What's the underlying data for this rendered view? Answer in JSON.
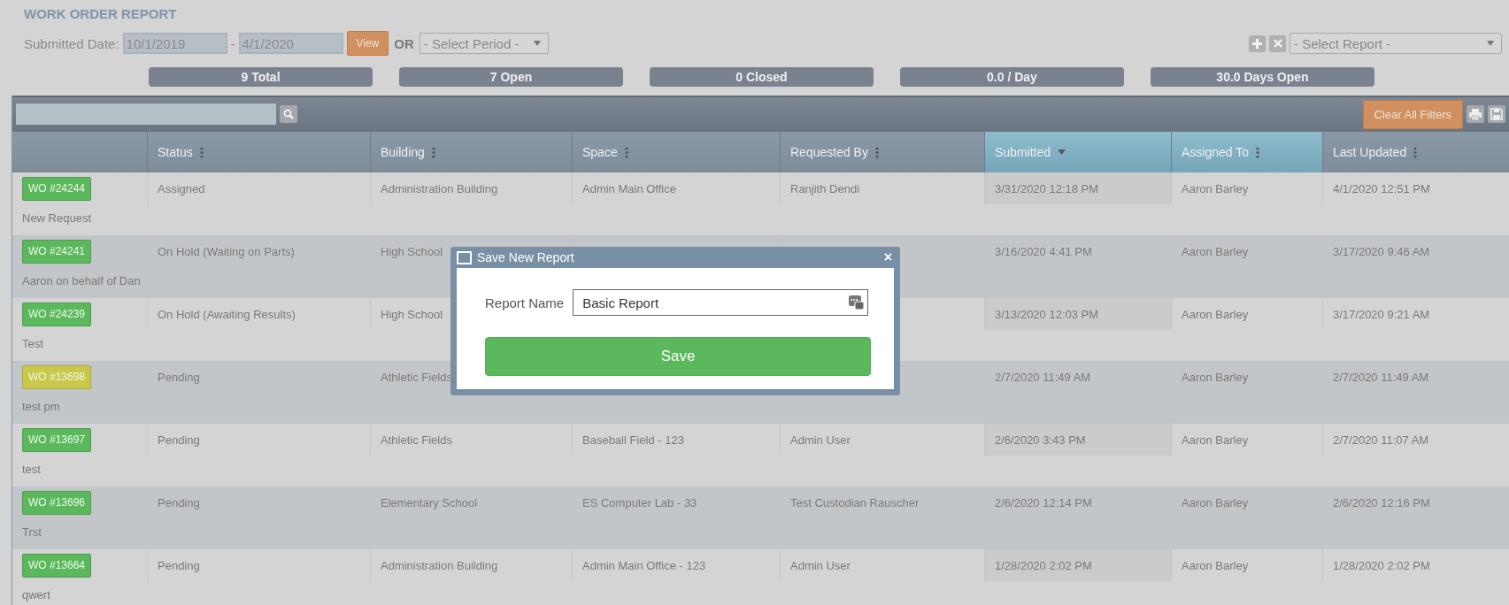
{
  "title": "WORK ORDER REPORT",
  "filters": {
    "label": "Submitted Date:",
    "from": "10/1/2019",
    "separator": "-",
    "to": "4/1/2020",
    "view_button": "View",
    "or_label": "OR",
    "period_placeholder": "- Select Period -",
    "report_placeholder": "- Select Report -"
  },
  "stats": [
    "9 Total",
    "7 Open",
    "0 Closed",
    "0.0 / Day",
    "30.0 Days Open"
  ],
  "toolbar": {
    "clear_button": "Clear All Filters"
  },
  "columns": [
    {
      "label": "Status",
      "sorted": false,
      "highlighted": false
    },
    {
      "label": "Building",
      "sorted": false,
      "highlighted": false
    },
    {
      "label": "Space",
      "sorted": false,
      "highlighted": false
    },
    {
      "label": "Requested By",
      "sorted": false,
      "highlighted": false
    },
    {
      "label": "Submitted",
      "sorted": true,
      "highlighted": true
    },
    {
      "label": "Assigned To",
      "sorted": false,
      "highlighted": true
    },
    {
      "label": "Last Updated",
      "sorted": false,
      "highlighted": false
    }
  ],
  "rows": [
    {
      "wo": "WO #24244",
      "color": "#5cb85c",
      "cells": [
        "Assigned",
        "Administration Building",
        "Admin Main Office",
        "Ranjith Dendi",
        "3/31/2020 12:18 PM",
        "Aaron Barley",
        "4/1/2020 12:51 PM"
      ],
      "description": "New Request"
    },
    {
      "wo": "WO #24241",
      "color": "#5cb85c",
      "cells": [
        "On Hold (Waiting on Parts)",
        "High School",
        null,
        null,
        "3/16/2020 4:41 PM",
        "Aaron Barley",
        "3/17/2020 9:46 AM"
      ],
      "description": "Aaron on behalf of Dan"
    },
    {
      "wo": "WO #24239",
      "color": "#5cb85c",
      "cells": [
        "On Hold (Awaiting Results)",
        "High School",
        null,
        null,
        "3/13/2020 12:03 PM",
        "Aaron Barley",
        "3/17/2020 9:21 AM"
      ],
      "description": "Test"
    },
    {
      "wo": "WO #13698",
      "color": "#c9c84a",
      "cells": [
        "Pending",
        "Athletic Fields",
        null,
        null,
        "2/7/2020 11:49 AM",
        "Aaron Barley",
        "2/7/2020 11:49 AM"
      ],
      "description": "test pm"
    },
    {
      "wo": "WO #13697",
      "color": "#5cb85c",
      "cells": [
        "Pending",
        "Athletic Fields",
        "Baseball Field - 123",
        "Admin User",
        "2/6/2020 3:43 PM",
        "Aaron Barley",
        "2/7/2020 11:07 AM"
      ],
      "description": "test"
    },
    {
      "wo": "WO #13696",
      "color": "#5cb85c",
      "cells": [
        "Pending",
        "Elementary School",
        "ES Computer Lab - 33",
        "Test Custodian Rauscher",
        "2/6/2020 12:14 PM",
        "Aaron Barley",
        "2/6/2020 12:16 PM"
      ],
      "description": "Trst"
    },
    {
      "wo": "WO #13664",
      "color": "#5cb85c",
      "cells": [
        "Pending",
        "Administration Building",
        "Admin Main Office - 123",
        "Admin User",
        "1/28/2020 2:02 PM",
        "Aaron Barley",
        "1/28/2020 2:02 PM"
      ],
      "description": "qwert"
    }
  ],
  "dialog": {
    "title": "Save New Report",
    "close": "×",
    "field_label": "Report Name",
    "field_value": "Basic Report",
    "save_button": "Save"
  }
}
